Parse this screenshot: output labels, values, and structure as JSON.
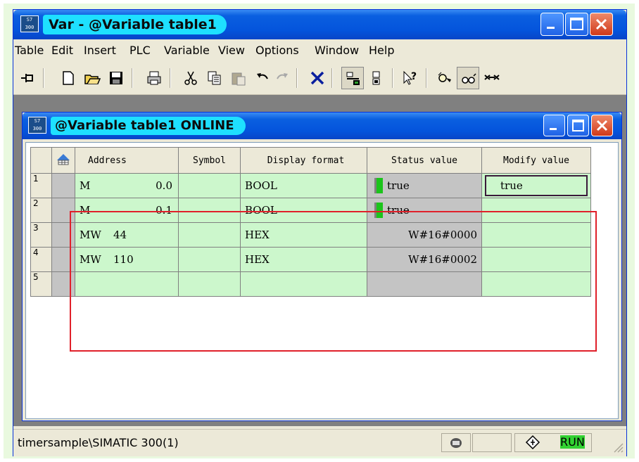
{
  "window": {
    "title": "Var - @Variable table1",
    "controls": [
      "minimize-icon",
      "maximize-icon",
      "close-icon"
    ]
  },
  "menu": [
    "Table",
    "Edit",
    "Insert",
    "PLC",
    "Variable",
    "View",
    "Options",
    "Window",
    "Help"
  ],
  "toolbar": {
    "icons": [
      "pin-icon",
      "new-icon",
      "open-icon",
      "save-icon",
      "print-icon",
      "cut-icon",
      "copy-icon",
      "paste-icon",
      "undo-icon",
      "redo-icon",
      "delete-icon",
      "monitor-variable-icon",
      "modify-variable-icon",
      "help-pointer-icon",
      "glasses-monitor-icon",
      "glasses-modify-icon",
      "force-icon"
    ]
  },
  "child_window": {
    "title": "@Variable table1  ONLINE"
  },
  "table": {
    "columns": [
      "Address",
      "Symbol",
      "Display format",
      "Status value",
      "Modify value"
    ],
    "rows": [
      {
        "num": "1",
        "addr_type": "M",
        "addr_val": "0.0",
        "symbol": "",
        "format": "BOOL",
        "status": "true",
        "indicator": true,
        "modify": "true"
      },
      {
        "num": "2",
        "addr_type": "M",
        "addr_val": "0.1",
        "symbol": "",
        "format": "BOOL",
        "status": "true",
        "indicator": true,
        "modify": ""
      },
      {
        "num": "3",
        "addr_type": "MW",
        "addr_val": "44",
        "symbol": "",
        "format": "HEX",
        "status": "W#16#0000",
        "indicator": false,
        "modify": ""
      },
      {
        "num": "4",
        "addr_type": "MW",
        "addr_val": "110",
        "symbol": "",
        "format": "HEX",
        "status": "W#16#0002",
        "indicator": false,
        "modify": ""
      },
      {
        "num": "5",
        "addr_type": "",
        "addr_val": "",
        "symbol": "",
        "format": "",
        "status": "",
        "indicator": false,
        "modify": ""
      }
    ]
  },
  "status_bar": {
    "path": "timersample\\SIMATIC 300(1)",
    "mode": "RUN"
  },
  "colors": {
    "title_blue": "#0454dc",
    "title_pill": "#1ee0ff",
    "cell_green": "#ccf7cc",
    "cell_gray": "#c4c4c4",
    "indicator_green": "#1bc41b",
    "selection_red": "#e0202a"
  }
}
